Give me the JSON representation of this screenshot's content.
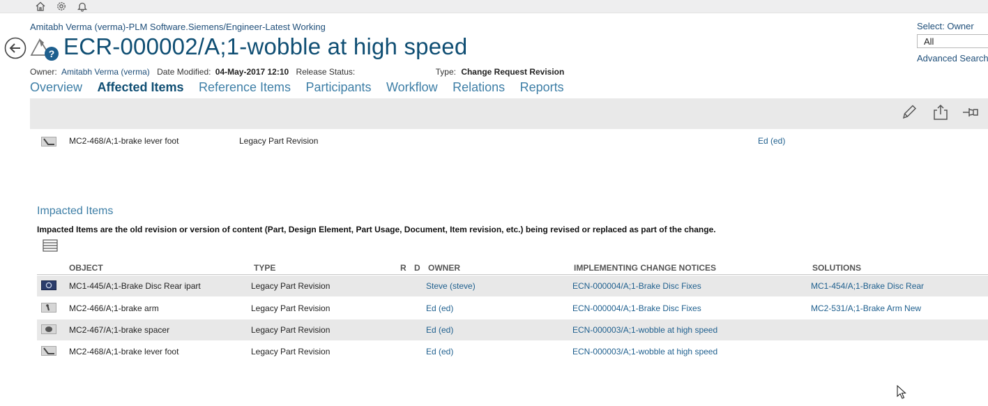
{
  "topbar": {
    "icons": [
      "home-icon",
      "gear-icon",
      "bell-icon"
    ]
  },
  "header": {
    "context": "Amitabh Verma (verma)-PLM Software.Siemens/Engineer-Latest Working",
    "title": "ECR-000002/A;1-wobble at high speed",
    "owner_label": "Owner:",
    "owner_value": "Amitabh Verma (verma)",
    "date_label": "Date Modified:",
    "date_value": "04-May-2017 12:10",
    "release_label": "Release Status:",
    "type_label": "Type:",
    "type_value": "Change Request Revision"
  },
  "owner_filter": {
    "label": "Select: Owner",
    "value": "All",
    "advanced_search": "Advanced Search"
  },
  "tabs": [
    {
      "label": "Overview",
      "active": false
    },
    {
      "label": "Affected Items",
      "active": true
    },
    {
      "label": "Reference Items",
      "active": false
    },
    {
      "label": "Participants",
      "active": false
    },
    {
      "label": "Workflow",
      "active": false
    },
    {
      "label": "Relations",
      "active": false
    },
    {
      "label": "Reports",
      "active": false
    }
  ],
  "toolbar": {
    "icons": [
      "edit-icon",
      "share-icon",
      "pin-icon"
    ]
  },
  "affected_items": [
    {
      "object": "MC2-468/A;1-brake lever foot",
      "type": "Legacy Part Revision",
      "owner": "Ed (ed)"
    }
  ],
  "impacted": {
    "title": "Impacted Items",
    "description": "Impacted Items are the old revision or version of content (Part, Design Element, Part Usage, Document, Item revision, etc.) being revised or replaced as part of the change.",
    "columns": {
      "object": "OBJECT",
      "type": "TYPE",
      "r": "R",
      "d": "D",
      "owner": "OWNER",
      "notices": "IMPLEMENTING CHANGE NOTICES",
      "solutions": "SOLUTIONS"
    },
    "rows": [
      {
        "object": "MC1-445/A;1-Brake Disc Rear ipart",
        "type": "Legacy Part Revision",
        "owner": "Steve (steve)",
        "notice": "ECN-000004/A;1-Brake Disc Fixes",
        "solution": "MC1-454/A;1-Brake Disc Rear",
        "icon": "disc-icon"
      },
      {
        "object": "MC2-466/A;1-brake arm",
        "type": "Legacy Part Revision",
        "owner": "Ed (ed)",
        "notice": "ECN-000004/A;1-Brake Disc Fixes",
        "solution": "MC2-531/A;1-Brake Arm New",
        "icon": "arm-icon"
      },
      {
        "object": "MC2-467/A;1-brake spacer",
        "type": "Legacy Part Revision",
        "owner": "Ed (ed)",
        "notice": "ECN-000003/A;1-wobble at high speed",
        "solution": "",
        "icon": "spacer-icon"
      },
      {
        "object": "MC2-468/A;1-brake lever foot",
        "type": "Legacy Part Revision",
        "owner": "Ed (ed)",
        "notice": "ECN-000003/A;1-wobble at high speed",
        "solution": "",
        "icon": "lever-icon"
      }
    ]
  },
  "colors": {
    "title": "#0f4e73",
    "link": "#1e5f8e",
    "tab": "#3d7ea6",
    "toolbar_bg": "#e9e9e9",
    "row_shade": "#e8e8e8"
  }
}
